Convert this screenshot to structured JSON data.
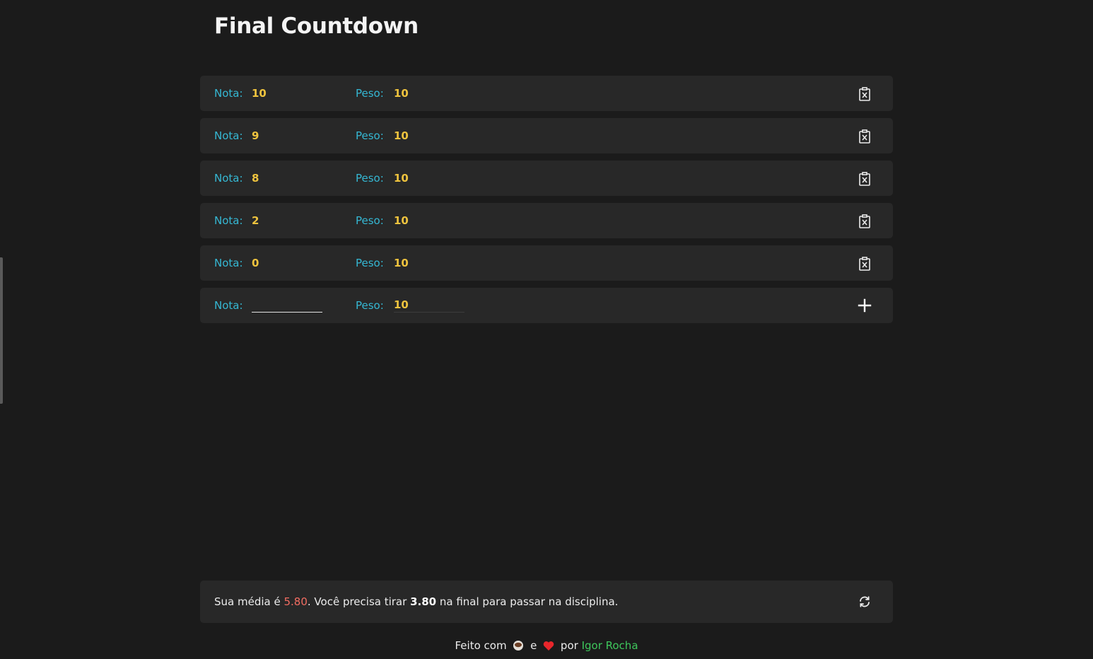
{
  "app": {
    "title": "Final Countdown"
  },
  "labels": {
    "nota": "Nota:",
    "peso": "Peso:"
  },
  "grades": [
    {
      "nota": "10",
      "peso": "10"
    },
    {
      "nota": "9",
      "peso": "10"
    },
    {
      "nota": "8",
      "peso": "10"
    },
    {
      "nota": "2",
      "peso": "10"
    },
    {
      "nota": "0",
      "peso": "10"
    }
  ],
  "new_entry": {
    "nota_value": "",
    "peso_value": "10"
  },
  "icons": {
    "delete": "clipboard-x-icon",
    "add": "plus-icon",
    "refresh": "refresh-icon",
    "coffee": "coffee-icon",
    "heart": "heart-icon"
  },
  "result": {
    "prefix": "Sua média é ",
    "average": "5.80",
    "middle": ". Você precisa tirar ",
    "needed": "3.80",
    "suffix": " na final para passar na disciplina."
  },
  "footer": {
    "made_with": "Feito com",
    "and": "e",
    "by": "por",
    "author": "Igor Rocha"
  },
  "colors": {
    "background": "#1b1b1b",
    "card": "#282828",
    "label": "#35b8d4",
    "value": "#eec33e",
    "average": "#f26d62",
    "author": "#3ec75c",
    "heart": "#e8262b"
  }
}
